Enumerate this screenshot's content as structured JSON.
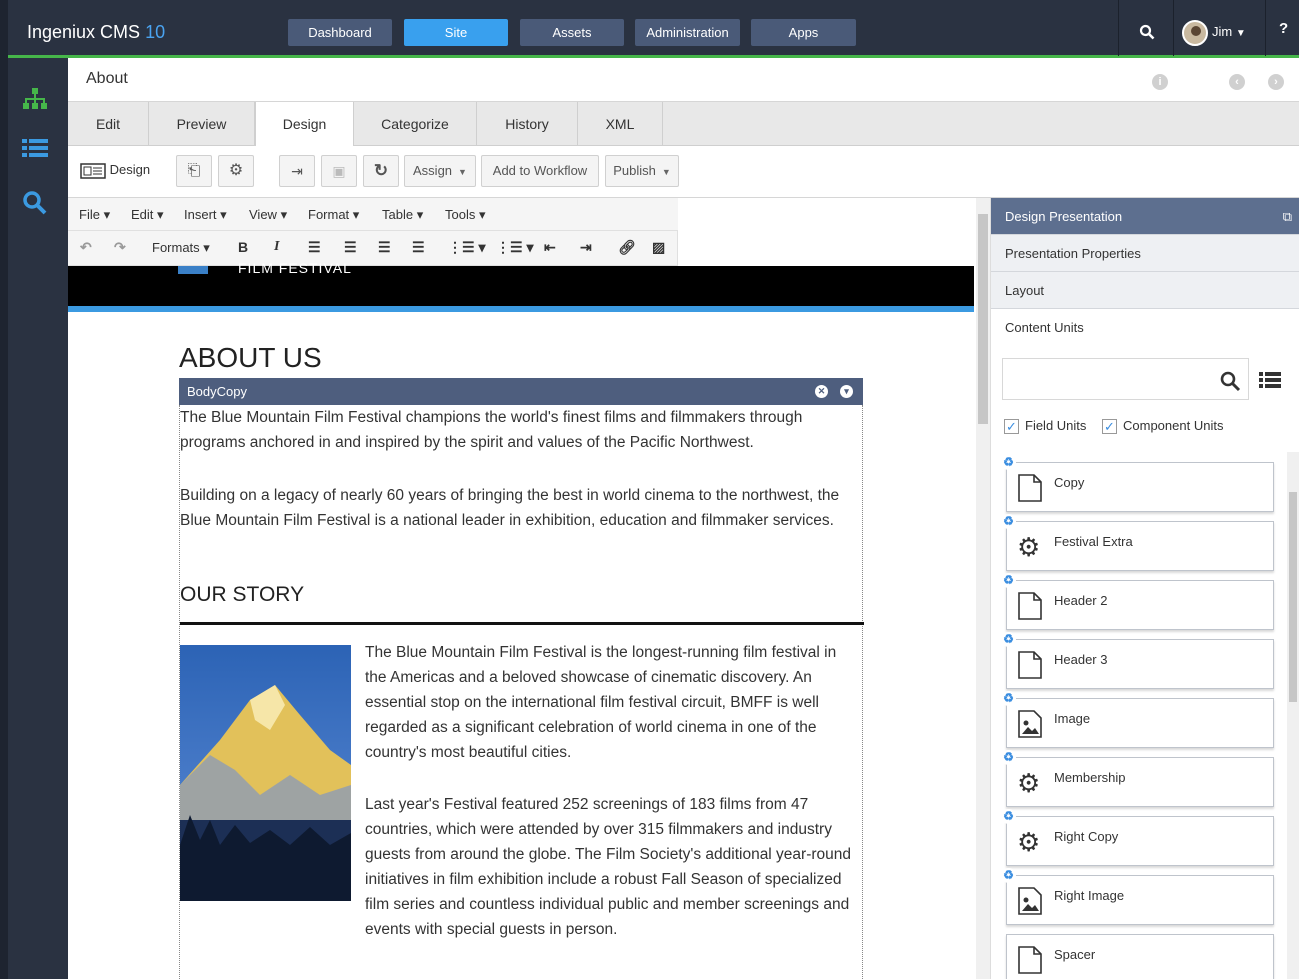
{
  "app": {
    "name": "Ingeniux CMS",
    "version": "10"
  },
  "topnav": {
    "items": [
      {
        "label": "Dashboard"
      },
      {
        "label": "Site",
        "active": true
      },
      {
        "label": "Assets"
      },
      {
        "label": "Administration"
      },
      {
        "label": "Apps"
      }
    ],
    "user": "Jim",
    "help": "?"
  },
  "page": {
    "title": "About"
  },
  "tabs": [
    "Edit",
    "Preview",
    "Design",
    "Categorize",
    "History",
    "XML"
  ],
  "active_tab": "Design",
  "toolbar": {
    "design_label": "Design",
    "assign_label": "Assign",
    "workflow_label": "Add to Workflow",
    "publish_label": "Publish"
  },
  "editor_menu": [
    "File",
    "Edit",
    "Insert",
    "View",
    "Format",
    "Table",
    "Tools"
  ],
  "formats_label": "Formats",
  "content": {
    "banner_text": "FILM FESTIVAL",
    "heading": "ABOUT US",
    "bodycopy_label": "BodyCopy",
    "p1": "The Blue Mountain Film Festival champions the world's finest films and filmmakers through programs anchored in and inspired by the spirit and values of the Pacific Northwest.",
    "p2": "Building on a legacy of nearly 60 years of bringing the best in world cinema to the northwest, the Blue Mountain Film Festival is a national leader in exhibition, education and filmmaker services.",
    "story_heading": "OUR STORY",
    "p3": "The Blue Mountain Film Festival is the longest-running film festival in the Americas and a beloved showcase of cinematic discovery. An essential stop on the international film festival circuit, BMFF is well regarded as a significant celebration of world cinema in one of the country's most beautiful cities.",
    "p4": "Last year's Festival featured 252 screenings of 183 films from 47 countries, which were attended by over 315 filmmakers and industry guests from around the globe. The Film Society's additional year-round initiatives in film exhibition include a robust Fall Season of specialized film series and countless individual public and member screenings and events with special guests in person."
  },
  "right_panel": {
    "sections": [
      "Design Presentation",
      "Presentation Properties",
      "Layout",
      "Content Units"
    ],
    "search_placeholder": "",
    "filters": [
      {
        "label": "Field Units",
        "checked": true
      },
      {
        "label": "Component Units",
        "checked": true
      }
    ],
    "units": [
      {
        "label": "Copy",
        "icon": "page-icon"
      },
      {
        "label": "Festival Extra",
        "icon": "gear-icon"
      },
      {
        "label": "Header 2",
        "icon": "page-icon"
      },
      {
        "label": "Header 3",
        "icon": "page-icon"
      },
      {
        "label": "Image",
        "icon": "image-icon"
      },
      {
        "label": "Membership",
        "icon": "gear-icon"
      },
      {
        "label": "Right Copy",
        "icon": "gear-icon"
      },
      {
        "label": "Right Image",
        "icon": "image-icon"
      },
      {
        "label": "Spacer",
        "icon": "page-icon"
      }
    ]
  },
  "colors": {
    "topbar": "#2a3241",
    "accent_green": "#46b64a",
    "active_blue": "#39a0ee",
    "panel_header": "#5d6f8f"
  }
}
